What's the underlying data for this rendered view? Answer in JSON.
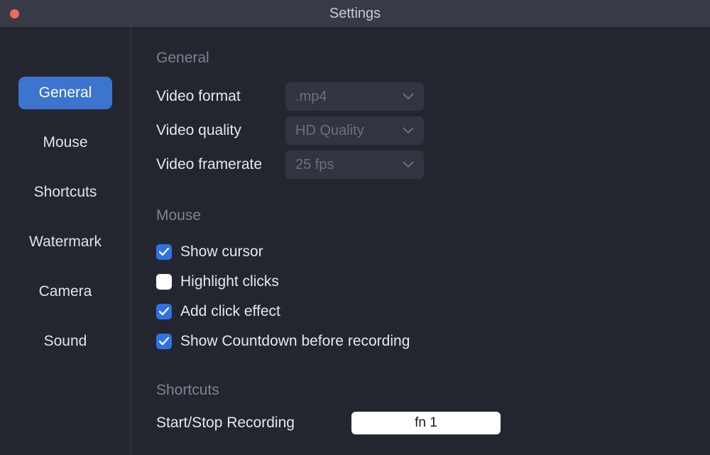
{
  "window": {
    "title": "Settings"
  },
  "sidebar": {
    "items": [
      {
        "label": "General",
        "active": true
      },
      {
        "label": "Mouse",
        "active": false
      },
      {
        "label": "Shortcuts",
        "active": false
      },
      {
        "label": "Watermark",
        "active": false
      },
      {
        "label": "Camera",
        "active": false
      },
      {
        "label": "Sound",
        "active": false
      }
    ]
  },
  "sections": {
    "general": {
      "title": "General",
      "video_format": {
        "label": "Video format",
        "value": ".mp4"
      },
      "video_quality": {
        "label": "Video quality",
        "value": "HD Quality"
      },
      "video_framerate": {
        "label": "Video framerate",
        "value": "25 fps"
      }
    },
    "mouse": {
      "title": "Mouse",
      "show_cursor": {
        "label": "Show cursor",
        "checked": true
      },
      "highlight_clicks": {
        "label": "Highlight clicks",
        "checked": false
      },
      "add_click_effect": {
        "label": "Add click effect",
        "checked": true
      },
      "show_countdown": {
        "label": "Show Countdown before recording",
        "checked": true
      }
    },
    "shortcuts": {
      "title": "Shortcuts",
      "start_stop": {
        "label": "Start/Stop Recording",
        "value": "fn 1"
      }
    }
  }
}
